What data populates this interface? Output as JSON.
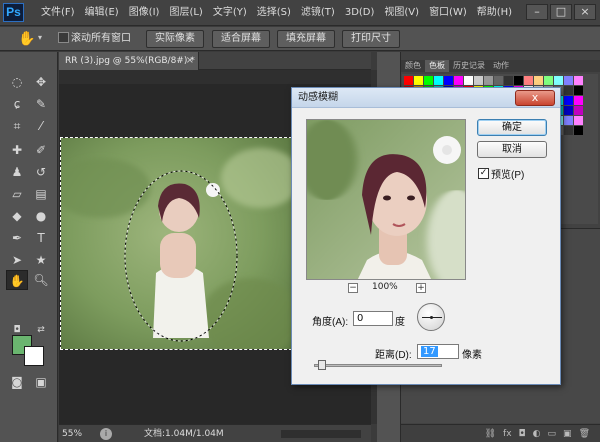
{
  "app": {
    "logo": "Ps"
  },
  "menu": [
    "文件(F)",
    "编辑(E)",
    "图像(I)",
    "图层(L)",
    "文字(Y)",
    "选择(S)",
    "滤镜(T)",
    "3D(D)",
    "视图(V)",
    "窗口(W)",
    "帮助(H)"
  ],
  "window_controls": {
    "minimize": "–",
    "maximize": "□",
    "close": "×"
  },
  "options_bar": {
    "scroll_all_label": "滚动所有窗口",
    "scroll_all_checked": false,
    "actual_pixels": "实际像素",
    "fit_screen": "适合屏幕",
    "fill_screen": "填充屏幕",
    "print_size": "打印尺寸"
  },
  "document": {
    "tab_title": "RR (3).jpg @ 55%(RGB/8#) *",
    "tab_close": "×",
    "zoom": "55%",
    "doc_info": "文档:1.04M/1.04M"
  },
  "panels": {
    "tabs": [
      "颜色",
      "色板",
      "历史记录",
      "动作"
    ],
    "active_tab": "色板"
  },
  "dialog": {
    "title": "动感模糊",
    "close": "x",
    "ok": "确定",
    "cancel": "取消",
    "preview_label": "预览(P)",
    "preview_checked": true,
    "zoom_out": "−",
    "zoom_in": "+",
    "zoom_value": "100%",
    "angle_label": "角度(A):",
    "angle_value": "0",
    "angle_unit": "度",
    "distance_label": "距离(D):",
    "distance_value": "17",
    "distance_unit": "像素"
  },
  "colors": {
    "foreground": "#6ab56f",
    "background": "#ffffff",
    "swatches": [
      "#ff0000",
      "#ffff00",
      "#00ff00",
      "#00ffff",
      "#0000ff",
      "#ff00ff",
      "#ffffff",
      "#cccccc",
      "#999999",
      "#666666",
      "#333333",
      "#000000",
      "#ff8080",
      "#ffd080",
      "#80ff80",
      "#80ffff",
      "#8080ff",
      "#ff80ff",
      "#c00000",
      "#c08000",
      "#00c000",
      "#00c0c0",
      "#0000c0",
      "#c000c0"
    ]
  }
}
